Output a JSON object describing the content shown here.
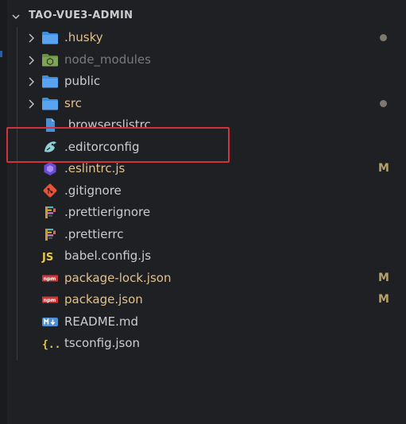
{
  "explorer": {
    "title": "TAO-VUE3-ADMIN",
    "items": [
      {
        "label": ".husky",
        "type": "folder",
        "color": "#e2c08d",
        "icon": "folder-icon",
        "badge": "dot"
      },
      {
        "label": "node_modules",
        "type": "folder",
        "color": "#7a7a7a",
        "icon": "node-folder-icon",
        "badge": ""
      },
      {
        "label": "public",
        "type": "folder",
        "color": "#cccccc",
        "icon": "folder-icon",
        "badge": ""
      },
      {
        "label": "src",
        "type": "folder",
        "color": "#e2c08d",
        "icon": "folder-icon",
        "badge": "dot"
      },
      {
        "label": ".browserslistrc",
        "type": "file",
        "color": "#cccccc",
        "icon": "file-icon",
        "badge": ""
      },
      {
        "label": ".editorconfig",
        "type": "file",
        "color": "#cccccc",
        "icon": "editorconfig-icon",
        "badge": ""
      },
      {
        "label": ".eslintrc.js",
        "type": "file",
        "color": "#e2c08d",
        "icon": "eslint-icon",
        "badge": "M"
      },
      {
        "label": ".gitignore",
        "type": "file",
        "color": "#cccccc",
        "icon": "git-icon",
        "badge": ""
      },
      {
        "label": ".prettierignore",
        "type": "file",
        "color": "#cccccc",
        "icon": "prettier-icon",
        "badge": ""
      },
      {
        "label": ".prettierrc",
        "type": "file",
        "color": "#cccccc",
        "icon": "prettier-icon",
        "badge": ""
      },
      {
        "label": "babel.config.js",
        "type": "file",
        "color": "#cccccc",
        "icon": "js-icon",
        "badge": ""
      },
      {
        "label": "package-lock.json",
        "type": "file",
        "color": "#e2c08d",
        "icon": "npm-icon",
        "badge": "M"
      },
      {
        "label": "package.json",
        "type": "file",
        "color": "#e2c08d",
        "icon": "npm-icon",
        "badge": "M"
      },
      {
        "label": "README.md",
        "type": "file",
        "color": "#cccccc",
        "icon": "markdown-icon",
        "badge": ""
      },
      {
        "label": "tsconfig.json",
        "type": "file",
        "color": "#cccccc",
        "icon": "json-icon",
        "badge": ""
      }
    ],
    "badges": {
      "modified": "M"
    },
    "accent": {
      "highlight_border": "#d0343a",
      "modified": "#e2c08d"
    }
  }
}
